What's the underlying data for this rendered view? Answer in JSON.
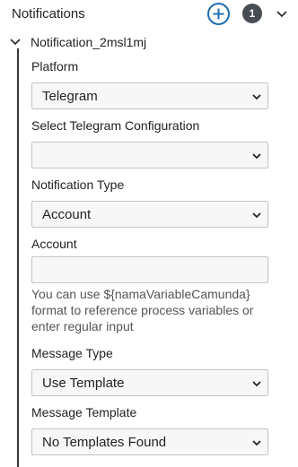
{
  "header": {
    "title": "Notifications",
    "count": "1",
    "add_icon": "plus-circle-icon",
    "collapse_icon": "chevron-down-icon"
  },
  "notification": {
    "id": "Notification_2msl1mj",
    "expand_icon": "chevron-down-icon",
    "platform": {
      "label": "Platform",
      "value": "Telegram"
    },
    "telegram_config": {
      "label": "Select Telegram Configuration",
      "value": ""
    },
    "notification_type": {
      "label": "Notification Type",
      "value": "Account"
    },
    "account": {
      "label": "Account",
      "value": "",
      "hint": "You can use ${namaVariableCamunda} format to reference process variables or enter regular input"
    },
    "message_type": {
      "label": "Message Type",
      "value": "Use Template"
    },
    "message_template": {
      "label": "Message Template",
      "value": "No Templates Found"
    }
  },
  "colors": {
    "accent": "#1f6fb2",
    "badge": "#474b52",
    "field_bg": "#f7f7f7",
    "field_border": "#c4c4c4"
  }
}
